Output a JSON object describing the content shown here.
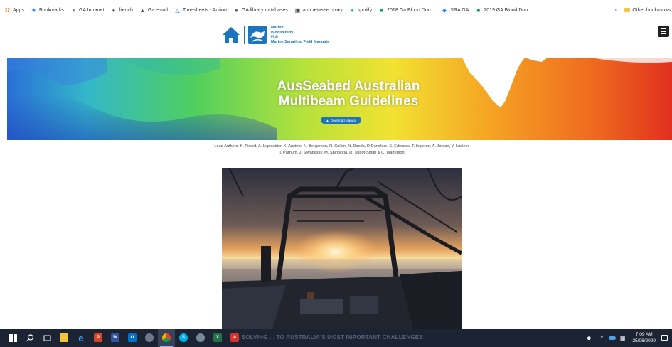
{
  "bookmarks": {
    "items": [
      {
        "label": "Apps",
        "icon": "apps-grid-icon",
        "color": "#e8710a"
      },
      {
        "label": "Bookmarks",
        "icon": "star-icon",
        "color": "#1a73e8"
      },
      {
        "label": "GA Intranet",
        "icon": "globe-icon",
        "color": "#888888"
      },
      {
        "label": "french",
        "icon": "globe-icon",
        "color": "#555555"
      },
      {
        "label": "Ga email",
        "icon": "mail-icon",
        "color": "#555555"
      },
      {
        "label": "Timesheets - Aurion",
        "icon": "triangle-icon",
        "color": "#2a62c9"
      },
      {
        "label": "GA library databases",
        "icon": "globe-icon",
        "color": "#555555"
      },
      {
        "label": "anu reverse proxy",
        "icon": "image-icon",
        "color": "#444444"
      },
      {
        "label": "spotify",
        "icon": "spotify-icon",
        "color": "#1db954"
      },
      {
        "label": "2018 Ga Blood Don...",
        "icon": "sheet-icon",
        "color": "#0f9d58"
      },
      {
        "label": "JIRA GA",
        "icon": "jira-icon",
        "color": "#2684ff"
      },
      {
        "label": "2019 GA Blood Don...",
        "icon": "sheet-icon",
        "color": "#0f9d58"
      }
    ],
    "overflow": "»",
    "other": "Other bookmarks"
  },
  "header": {
    "logo_line1": "Marine",
    "logo_line2": "Biodiversity",
    "logo_line3": "Hub",
    "logo_line4": "Marine Sampling Field Manuals",
    "brand_color": "#1b75bc"
  },
  "hero": {
    "title_line1": "AusSeabed Australian",
    "title_line2": "Multibeam Guidelines",
    "download_label": "Download Manual"
  },
  "authors": {
    "text": "Lead Authors: K. Picard, A. Leplastrier, K. Austine, N. Bergersen, R. Cullen, N. Dando, D.Donohue, S. Edwards, T. Ingleton, A. Jordan, V. Lucieer, I. Parnum, J. Siwabessy, M. Spinoccia, R. Talbot-Smith & C. Watterson"
  },
  "caption": {
    "text": "... SOLVING ... TO AUSTRALIA'S MOST IMPORTANT CHALLENGES"
  },
  "taskbar": {
    "time": "7:09 AM",
    "date": "25/06/2020"
  }
}
